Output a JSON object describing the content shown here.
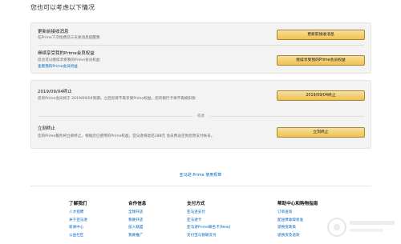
{
  "page_title": "您也可以考虑以下情况",
  "section1": {
    "update_title": "更新前接收消息",
    "update_desc": "在Prime下次续费前三天发消息提醒我",
    "update_button": "更新前接收消息",
    "continue_title": "继续享受我的Prime会员权益",
    "continue_desc": "您也可以继续享受我的Prime会员权益",
    "continue_link": "查看我的Prime会员权益",
    "continue_button": "继续享受我的Prime会员权益"
  },
  "section2": {
    "end_date_title": "2019/09/04终止",
    "end_date_desc": "您的Prime会员将于 2019/09/04到期。之后您将不再享受Prime权益，您的银行卡将不再被扣款",
    "end_date_button": "2019/09/04终止",
    "or_text": "或者",
    "immediate_title": "立刻终止",
    "immediate_desc": "您的Prime服务将立即终止。根据您已使用的Prime权益，亚马逊将退还288元 会员费返还到您原支付帐号。",
    "immediate_button": "立刻终止"
  },
  "terms_link": "亚马逊 Prime 使用规章",
  "footer": {
    "columns": [
      {
        "heading": "了解我们",
        "items": [
          "人才招聘",
          "关于亚马逊",
          "新闻中心",
          "公益社区"
        ]
      },
      {
        "heading": "合作信息",
        "items": [
          "全球开店",
          "我要开店",
          "加入联盟",
          "我要推广"
        ]
      },
      {
        "heading": "支付方式",
        "items": [
          "亚马逊支付",
          "亚马逊卡",
          "亚马逊Prime联名卡[New]",
          "支付宝与银联支付"
        ]
      },
      {
        "heading": "帮助中心和购物指南",
        "items": [
          "订单查询",
          "配送费收取标准",
          "退换货政策",
          "退换货及退款"
        ]
      }
    ]
  }
}
